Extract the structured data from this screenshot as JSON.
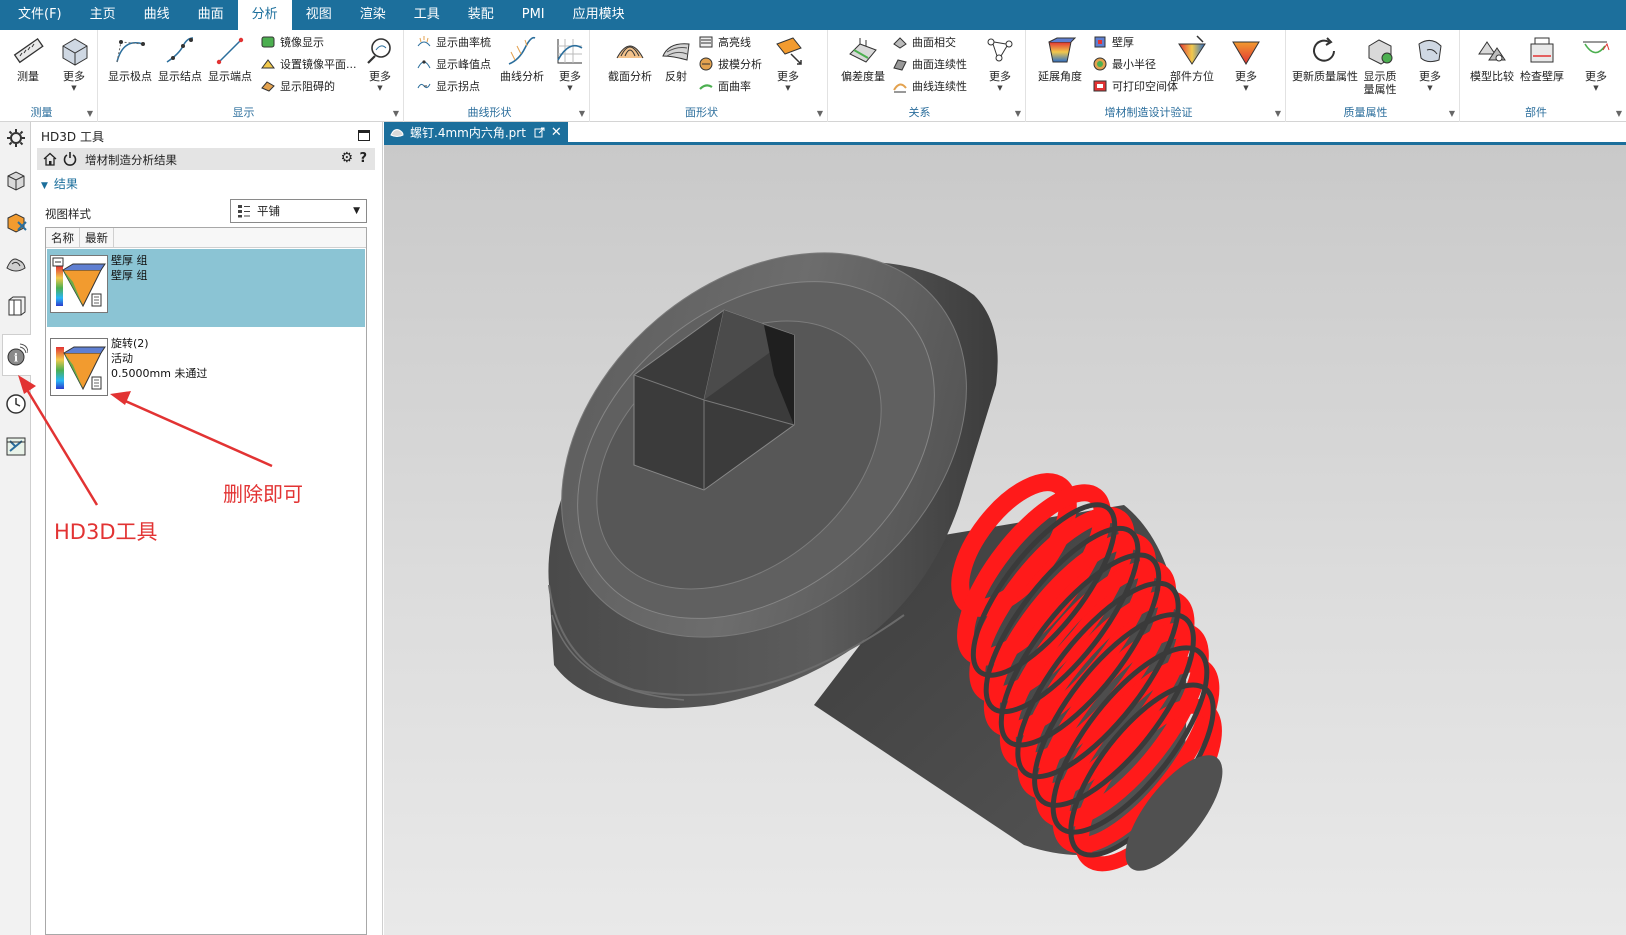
{
  "menubar": {
    "items": [
      "文件(F)",
      "主页",
      "曲线",
      "曲面",
      "分析",
      "视图",
      "渲染",
      "工具",
      "装配",
      "PMI",
      "应用模块"
    ],
    "active": "分析"
  },
  "ribbon": {
    "groups": {
      "measure": "测量",
      "display": "显示",
      "curve_shape": "曲线形状",
      "face_shape": "面形状",
      "relation": "关系",
      "am_verify": "增材制造设计验证",
      "mass": "质量属性",
      "part": "部件"
    },
    "buttons": {
      "measure": "测量",
      "more": "更多",
      "show_poles": "显示极点",
      "show_knots": "显示结点",
      "show_endpoints": "显示端点",
      "mirror_display": "镜像显示",
      "set_mirror_plane": "设置镜像平面...",
      "show_hidden": "显示阻碍的",
      "show_comb": "显示曲率梳",
      "show_peak": "显示峰值点",
      "show_inflection": "显示拐点",
      "curve_analysis": "曲线分析",
      "section_analysis": "截面分析",
      "reflection": "反射",
      "highlight_lines": "高亮线",
      "draft_analysis": "拔模分析",
      "face_curvature": "面曲率",
      "deviation": "偏差度量",
      "face_intersect": "曲面相交",
      "face_continuity": "曲面连续性",
      "curve_continuity": "曲线连续性",
      "overhang_angle": "延展角度",
      "wall_thickness": "壁厚",
      "min_radius": "最小半径",
      "printable_void": "可打印空间体",
      "part_orientation": "部件方位",
      "update_mass": "更新质量属性",
      "show_mass_line1": "显示质",
      "show_mass_line2": "量属性",
      "model_compare": "模型比较",
      "check_wall": "检查壁厚"
    }
  },
  "panel": {
    "title": "HD3D 工具",
    "header": "增材制造分析结果",
    "section": "结果",
    "view_style_label": "视图样式",
    "view_style_value": "平铺",
    "columns": [
      "名称",
      "最新"
    ],
    "items": [
      {
        "line1": "壁厚 组",
        "line2": "壁厚 组",
        "line3": ""
      },
      {
        "line1": "旋转(2)",
        "line2": "活动",
        "line3": "0.5000mm 未通过"
      }
    ]
  },
  "tab": {
    "file_name": "螺钉.4mm内六角.prt"
  },
  "annotations": {
    "hd3d": "HD3D工具",
    "delete": "删除即可"
  },
  "colors": {
    "accent": "#1c6f9c",
    "selected_row": "#8bc4d4",
    "annotation": "#e23333",
    "failed_area": "#ff1a1a"
  }
}
